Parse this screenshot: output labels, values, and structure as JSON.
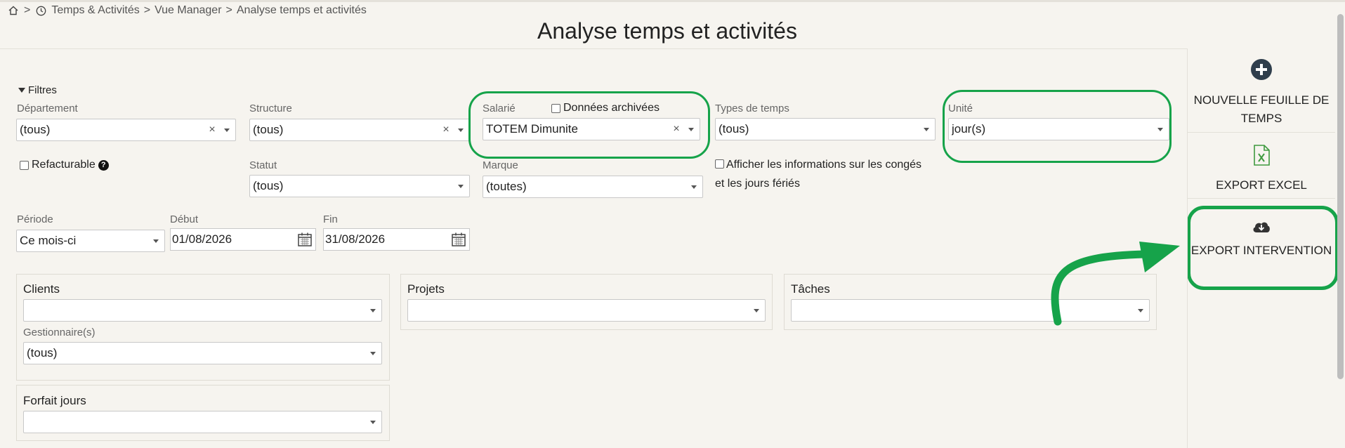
{
  "breadcrumb": {
    "sep": ">",
    "items": [
      "Temps & Activités",
      "Vue Manager",
      "Analyse temps et activités"
    ]
  },
  "page": {
    "title": "Analyse temps et activités"
  },
  "filters": {
    "toggle_label": "Filtres",
    "departement": {
      "label": "Département",
      "value": "(tous)"
    },
    "structure": {
      "label": "Structure",
      "value": "(tous)"
    },
    "salarie": {
      "label": "Salarié",
      "value": "TOTEM Dimunite",
      "archived_label": "Données archivées"
    },
    "types_temps": {
      "label": "Types de temps",
      "value": "(tous)"
    },
    "unite": {
      "label": "Unité",
      "value": "jour(s)"
    },
    "refacturable_label": "Refacturable",
    "statut": {
      "label": "Statut",
      "value": "(tous)"
    },
    "marque": {
      "label": "Marque",
      "value": "(toutes)"
    },
    "conges_label": "Afficher les informations sur les congés et les jours fériés",
    "periode": {
      "label": "Période",
      "value": "Ce mois-ci"
    },
    "debut": {
      "label": "Début",
      "value": "01/08/2026"
    },
    "fin": {
      "label": "Fin",
      "value": "31/08/2026"
    }
  },
  "panels": {
    "clients": {
      "title": "Clients",
      "value": ""
    },
    "gestionnaires": {
      "label": "Gestionnaire(s)",
      "value": "(tous)"
    },
    "projets": {
      "title": "Projets",
      "value": ""
    },
    "taches": {
      "title": "Tâches",
      "value": ""
    },
    "forfait": {
      "title": "Forfait jours",
      "value": ""
    }
  },
  "sidebar": {
    "new_sheet_label": "NOUVELLE FEUILLE DE TEMPS",
    "export_excel_label": "EXPORT EXCEL",
    "export_intervention_label": "EXPORT INTERVENTION"
  },
  "colors": {
    "highlight": "#16a34a",
    "excel": "#3f9a3f",
    "background": "#f6f4ef"
  },
  "icons": {
    "home": "home-icon",
    "clock": "clock-icon",
    "plus": "plus-circle-icon",
    "excel": "excel-icon",
    "cloud": "cloud-download-icon",
    "calendar": "calendar-icon"
  }
}
